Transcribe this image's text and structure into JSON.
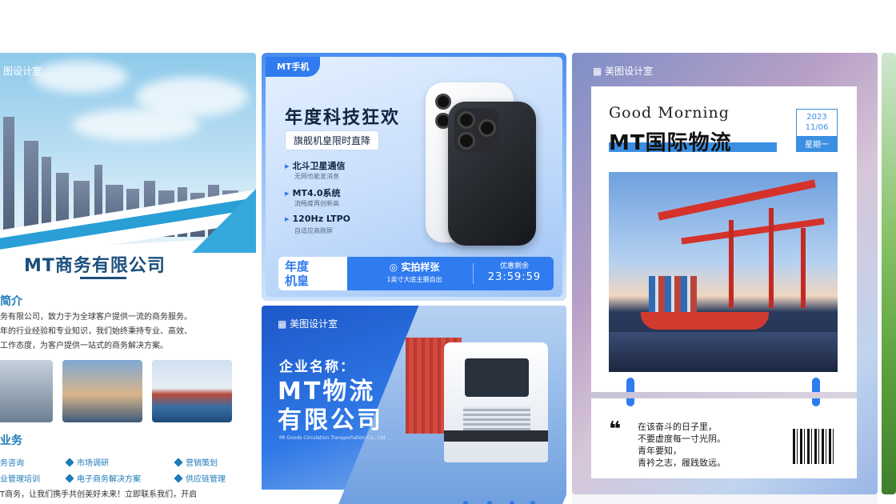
{
  "gallery": {
    "business_card": {
      "brand_tag": "图设计室",
      "company_title": "MT商务有限公司",
      "intro_heading": "简介",
      "intro_lines": [
        "务有限公司，致力于为全球客户提供一流的商务服务。",
        "年的行业经验和专业知识，我们始终秉持专业、高效、",
        "工作态度，为客户提供一站式的商务解决方案。"
      ],
      "services_heading": "业务",
      "services": [
        "务咨询",
        "市场调研",
        "营销策划",
        "业管理培训",
        "电子商务解决方案",
        "供应链管理"
      ],
      "footer_line": "T商务，让我们携手共创美好未来！立即联系我们，开启"
    },
    "phone_card": {
      "brand_tag": "MT手机",
      "headline": "年度科技狂欢",
      "sub_pill": "旗舰机皇限时直降",
      "features": [
        {
          "title": "北斗卫星通信",
          "desc": "无网也能发消息"
        },
        {
          "title": "MT4.0系统",
          "desc": "流畅度再创新高"
        },
        {
          "title": "120Hz LTPO",
          "desc": "自适应高刷屏"
        }
      ],
      "bar_left": "年度\n机皇",
      "bar_left_1": "年度",
      "bar_left_2": "机皇",
      "bar_mid_title": "实拍样张",
      "bar_mid_sub": "1英寸大底主摄自出",
      "bar_right_title": "优惠剩余",
      "bar_right_timer": "23:59:59"
    },
    "logistics_card": {
      "brand_tag": "美图设计室",
      "label": "企业名称：",
      "name_line1": "MT物流",
      "name_line2": "有限公司",
      "small_text": "Mt Goods Circulation Transportation Co., Ltd."
    },
    "morning_card": {
      "brand_tag": "美图设计室",
      "greeting": "Good Morning",
      "title": "MT国际物流",
      "date_year": "2023",
      "date_day": "11/06",
      "date_weekday": "星期一",
      "quote_mark": "❝",
      "quote_lines": [
        "在该奋斗的日子里，",
        "不要虚度每一寸光阴。",
        "青年要知，",
        "青衿之志，履践致远。"
      ]
    }
  },
  "colors": {
    "accent_blue": "#2f7bef",
    "title_blue": "#1b4f7c",
    "service_blue": "#1e7bb8"
  }
}
